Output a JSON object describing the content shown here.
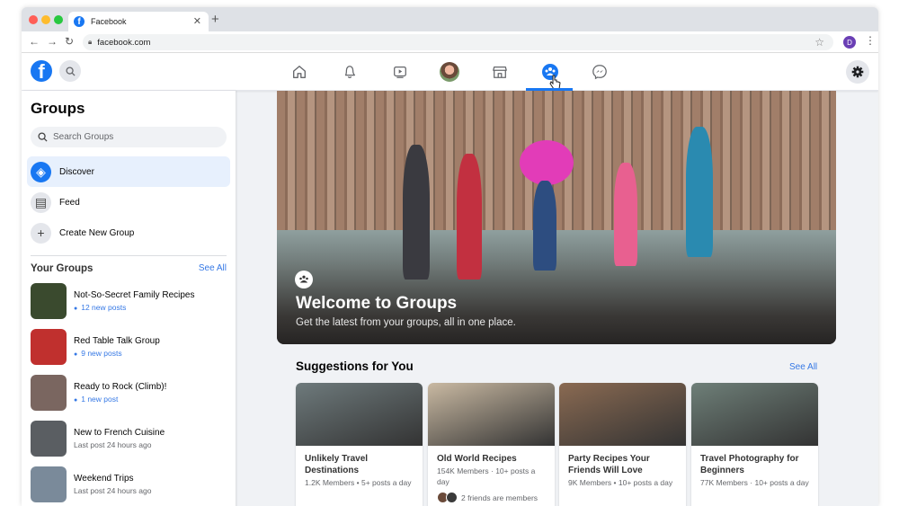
{
  "browser": {
    "tab_title": "Facebook",
    "url": "facebook.com",
    "profile_initial": "D",
    "icons": {
      "back": "arrow-left-icon",
      "forward": "arrow-right-icon",
      "reload": "reload-icon",
      "lock": "lock-icon",
      "bookmark": "star-icon",
      "menu": "kebab-icon"
    }
  },
  "topnav": {
    "items": [
      "home",
      "notifications",
      "watch",
      "profile",
      "marketplace",
      "groups",
      "messenger"
    ],
    "active": "groups"
  },
  "sidebar": {
    "title": "Groups",
    "search_placeholder": "Search Groups",
    "menu": [
      {
        "label": "Discover",
        "icon": "compass-icon",
        "active": true
      },
      {
        "label": "Feed",
        "icon": "feed-icon",
        "active": false
      },
      {
        "label": "Create New Group",
        "icon": "plus-icon",
        "active": false
      }
    ],
    "your_groups_title": "Your Groups",
    "see_all": "See All",
    "groups": [
      {
        "name": "Not-So-Secret Family Recipes",
        "status": "12 new posts",
        "new": true,
        "color": "#3a4a2e"
      },
      {
        "name": "Red Table Talk Group",
        "status": "9 new posts",
        "new": true,
        "color": "#c0302e"
      },
      {
        "name": "Ready to Rock (Climb)!",
        "status": "1 new post",
        "new": true,
        "color": "#7a6660"
      },
      {
        "name": "New to French Cuisine",
        "status": "Last post 24 hours ago",
        "new": false,
        "color": "#5a5e62"
      },
      {
        "name": "Weekend Trips",
        "status": "Last post 24 hours ago",
        "new": false,
        "color": "#7a8a9a"
      }
    ]
  },
  "hero": {
    "title": "Welcome to Groups",
    "subtitle": "Get the latest from your groups, all in one place."
  },
  "suggestions": {
    "title": "Suggestions for You",
    "see_all": "See All",
    "cards": [
      {
        "name": "Unlikely Travel Destinations",
        "meta": "1.2K Members • 5+ posts a day",
        "friends": "",
        "img": "#6e7a7c"
      },
      {
        "name": "Old World Recipes",
        "meta": "154K Members · 10+ posts a day",
        "friends": "2 friends are members",
        "img": "#c9b9a2"
      },
      {
        "name": "Party Recipes Your Friends Will Love",
        "meta": "9K Members • 10+ posts a day",
        "friends": "",
        "img": "#8a6a52"
      },
      {
        "name": "Travel Photography for Beginners",
        "meta": "77K Members · 10+ posts a day",
        "friends": "",
        "img": "#6e7f78"
      }
    ]
  }
}
